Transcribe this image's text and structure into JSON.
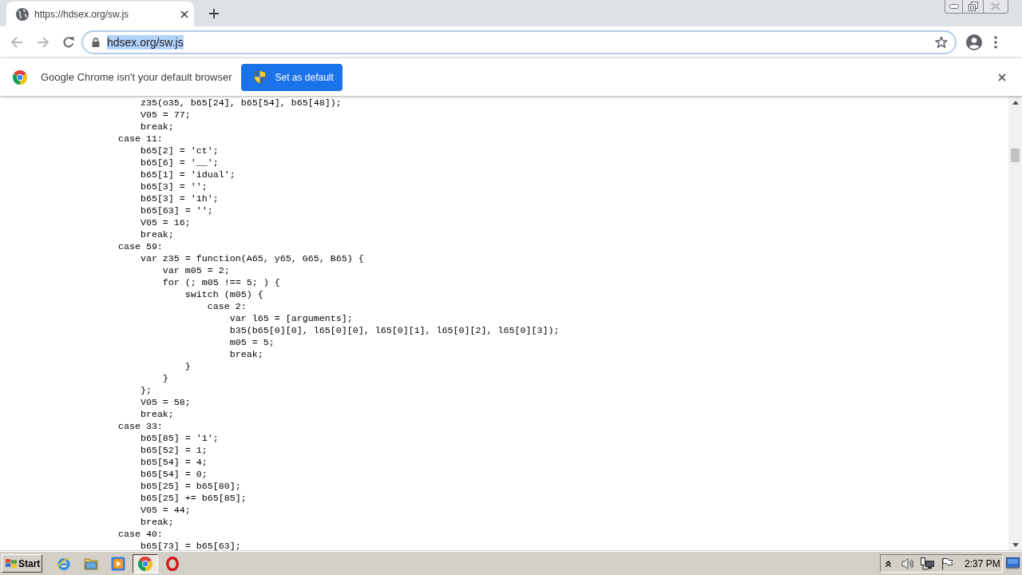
{
  "tabs": [
    {
      "title": "https://hdsex.org/sw.js",
      "selected": true
    }
  ],
  "address_bar": {
    "value": "hdsex.org/sw.js",
    "selected": true
  },
  "infobar": {
    "message": "Google Chrome isn't your default browser",
    "button": "Set as default"
  },
  "code_lines": [
    "                        z35(o35, b65[24], b65[54], b65[48]);",
    "                        V05 = 77;",
    "                        break;",
    "                    case 11:",
    "                        b65[2] = 'ct';",
    "                        b65[6] = '__';",
    "                        b65[1] = 'idual';",
    "                        b65[3] = '';",
    "                        b65[3] = '1h';",
    "                        b65[63] = '';",
    "                        V05 = 16;",
    "                        break;",
    "                    case 59:",
    "                        var z35 = function(A65, y65, G65, B65) {",
    "                            var m05 = 2;",
    "                            for (; m05 !== 5; ) {",
    "                                switch (m05) {",
    "                                    case 2:",
    "                                        var l65 = [arguments];",
    "                                        b35(b65[0][0], l65[0][0], l65[0][1], l65[0][2], l65[0][3]);",
    "                                        m05 = 5;",
    "                                        break;",
    "                                }",
    "                            }",
    "                        };",
    "                        V05 = 58;",
    "                        break;",
    "                    case 33:",
    "                        b65[85] = '1';",
    "                        b65[52] = 1;",
    "                        b65[54] = 4;",
    "                        b65[54] = 0;",
    "                        b65[25] = b65[80];",
    "                        b65[25] += b65[85];",
    "                        V05 = 44;",
    "                        break;",
    "                    case 40:",
    "                        b65[73] = b65[63];"
  ],
  "taskbar": {
    "start": "Start",
    "apps": [
      {
        "kind": "ie",
        "selected": false
      },
      {
        "kind": "folder",
        "selected": false
      },
      {
        "kind": "media",
        "selected": false
      },
      {
        "kind": "chrome",
        "selected": true
      },
      {
        "kind": "opera",
        "selected": false
      }
    ],
    "clock": "2:37 PM"
  }
}
